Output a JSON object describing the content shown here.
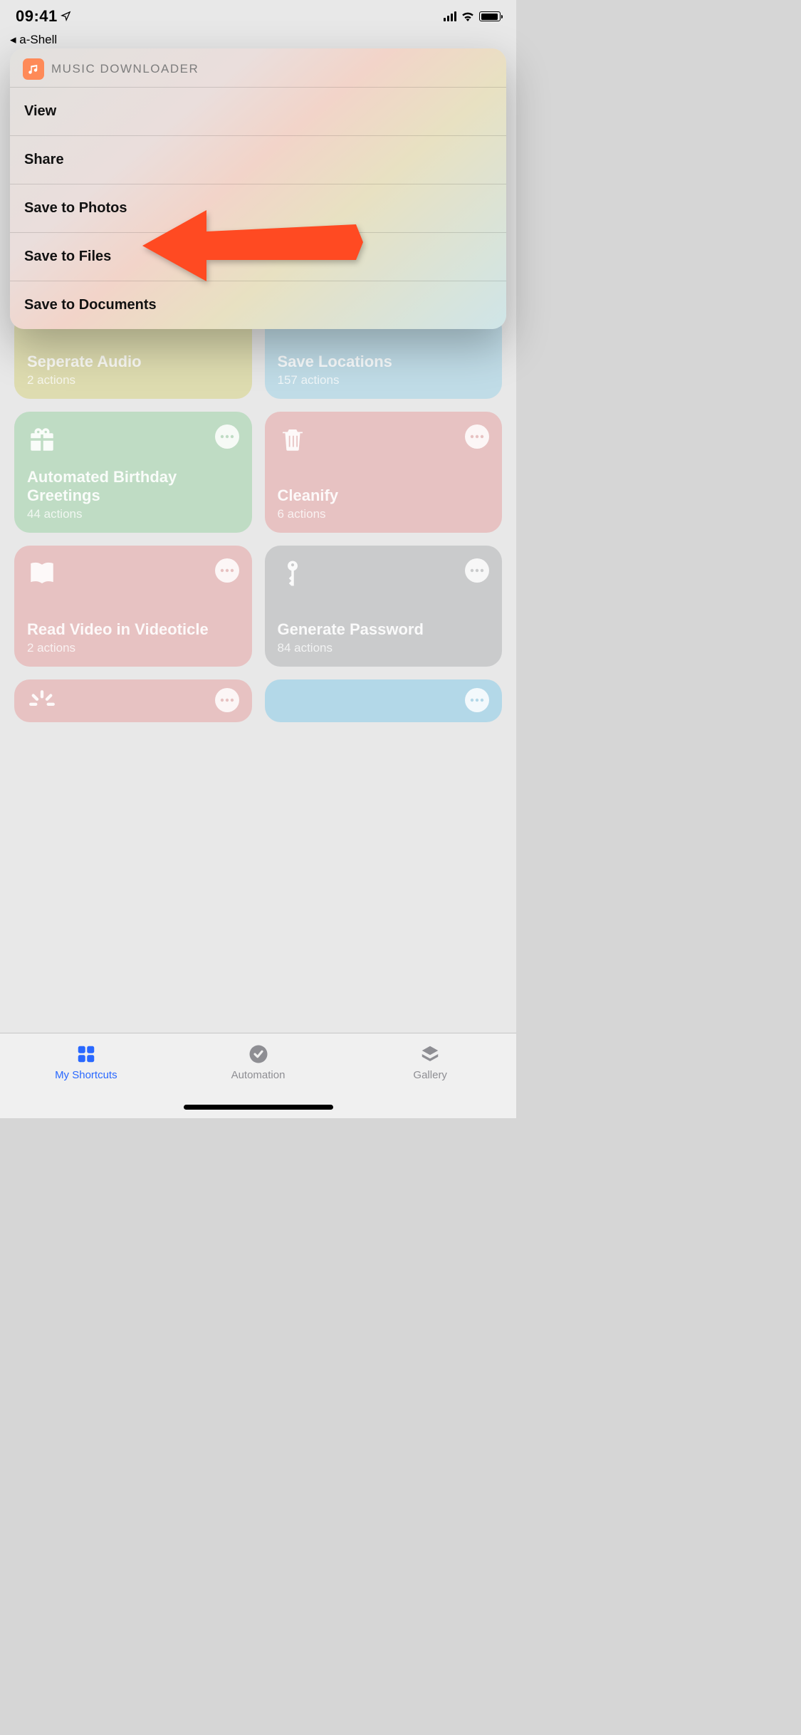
{
  "status": {
    "time": "09:41",
    "back_app": "◂ a-Shell"
  },
  "popup": {
    "app_title": "MUSIC DOWNLOADER",
    "items": [
      "View",
      "Share",
      "Save to Photos",
      "Save to Files",
      "Save to Documents"
    ]
  },
  "tiles": [
    {
      "title": "Seperate Audio",
      "sub": "2 actions"
    },
    {
      "title": "Save Locations",
      "sub": "157 actions"
    },
    {
      "title": "Automated Birthday Greetings",
      "sub": "44 actions"
    },
    {
      "title": "Cleanify",
      "sub": "6 actions"
    },
    {
      "title": "Read Video in Videoticle",
      "sub": "2 actions"
    },
    {
      "title": "Generate Password",
      "sub": "84 actions"
    }
  ],
  "tabs": {
    "my_shortcuts": "My Shortcuts",
    "automation": "Automation",
    "gallery": "Gallery"
  }
}
